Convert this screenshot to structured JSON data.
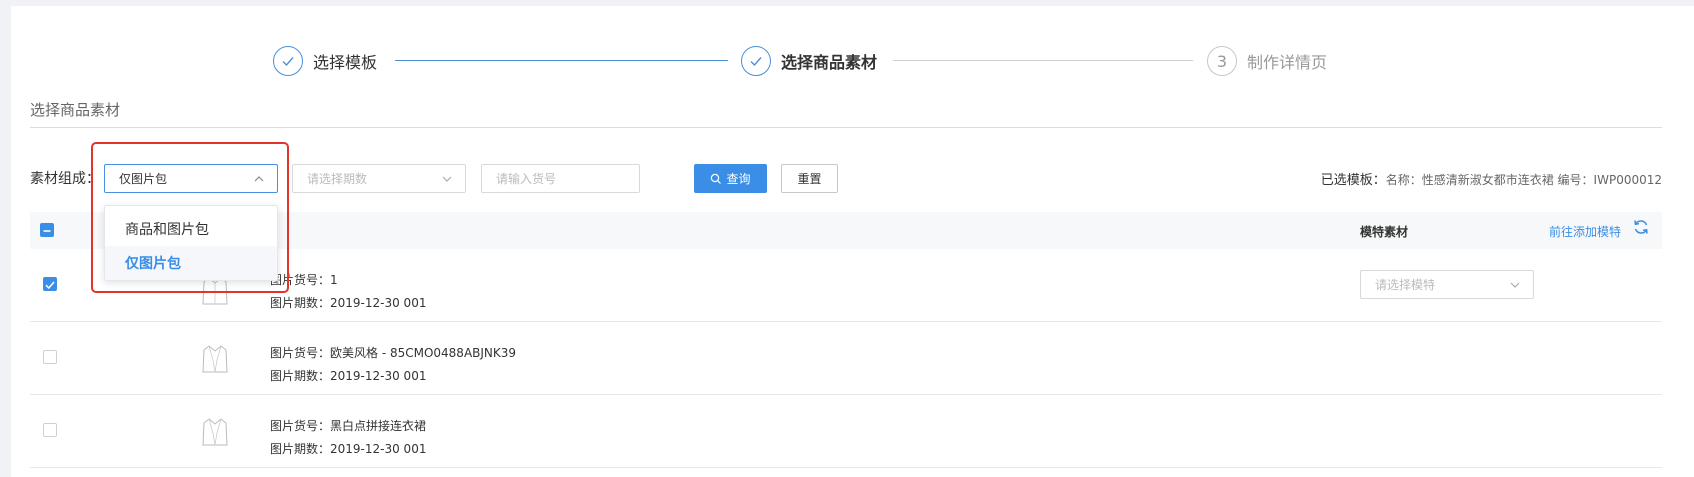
{
  "steps": [
    {
      "label": "选择模板",
      "state": "done"
    },
    {
      "label": "选择商品素材",
      "state": "active"
    },
    {
      "number": "3",
      "label": "制作详情页",
      "state": "pending"
    }
  ],
  "section_title": "选择商品素材",
  "filter": {
    "label": "素材组成：",
    "composition_value": "仅图片包",
    "period_placeholder": "请选择期数",
    "sku_placeholder": "请输入货号",
    "query_label": "查询",
    "reset_label": "重置"
  },
  "selected_template": {
    "prefix": "已选模板：",
    "detail": "名称：性感清新淑女都市连衣裙 编号：IWP000012"
  },
  "table": {
    "model_header": "模特素材",
    "add_model_link": "前往添加模特",
    "model_placeholder": "请选择模特",
    "rows": [
      {
        "sku_line": "图片货号：1",
        "period_line": "图片期数：2019-12-30 001",
        "checked": true
      },
      {
        "sku_line": "图片货号：欧美风格 - 85CMO0488ABJNK39",
        "period_line": "图片期数：2019-12-30 001",
        "checked": false
      },
      {
        "sku_line": "图片货号：黑白点拼接连衣裙",
        "period_line": "图片期数：2019-12-30 001",
        "checked": false
      }
    ]
  },
  "dropdown": {
    "options": [
      "商品和图片包",
      "仅图片包"
    ],
    "selected_index": 1
  },
  "colors": {
    "primary": "#3a8ee6",
    "highlight": "#e4332a"
  },
  "icons": [
    "check-icon",
    "chevron-up-icon",
    "chevron-down-icon",
    "search-icon",
    "refresh-icon",
    "clothing-thumbnail-icon"
  ]
}
